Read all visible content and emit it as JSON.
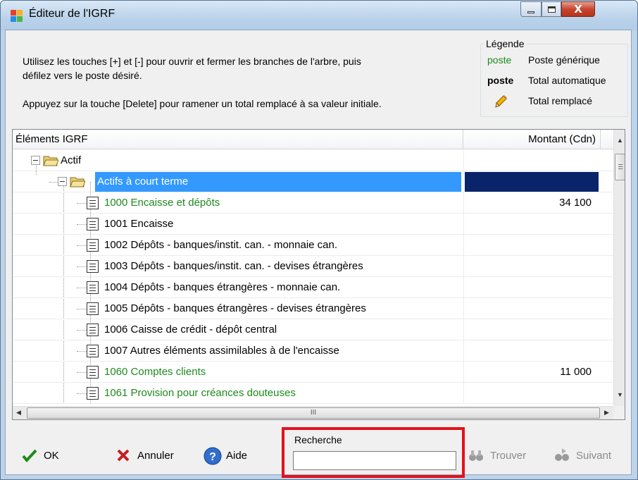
{
  "window": {
    "title": "Éditeur de l'IGRF",
    "close_glyph": "X"
  },
  "instructions": {
    "line1": "Utilisez les touches [+] et [-] pour ouvrir et fermer les branches de l'arbre, puis",
    "line2": "défilez vers le poste désiré.",
    "line3": "Appuyez sur la touche [Delete] pour ramener un total remplacé à sa valeur initiale."
  },
  "legend": {
    "title": "Légende",
    "items": [
      {
        "sample": "poste",
        "desc": "Poste générique",
        "style": "green"
      },
      {
        "sample": "poste",
        "desc": "Total automatique",
        "style": "bold"
      },
      {
        "sample": "",
        "desc": "Total remplacé",
        "style": "pencil-icon"
      }
    ]
  },
  "grid": {
    "col_items": "Éléments IGRF",
    "col_amount": "Montant (Cdn)",
    "rows": [
      {
        "label": "Actif",
        "amount": "",
        "type": "folder",
        "level": 0,
        "green": false
      },
      {
        "label": "Actifs à court terme",
        "amount": "",
        "type": "folder",
        "level": 1,
        "green": false,
        "selected": true
      },
      {
        "label": "1000  Encaisse et dépôts",
        "amount": "34 100",
        "type": "doc",
        "level": 2,
        "green": true
      },
      {
        "label": "1001  Encaisse",
        "amount": "",
        "type": "doc",
        "level": 2,
        "green": false
      },
      {
        "label": "1002  Dépôts - banques/instit. can. - monnaie can.",
        "amount": "",
        "type": "doc",
        "level": 2,
        "green": false
      },
      {
        "label": "1003  Dépôts - banques/instit. can. - devises étrangères",
        "amount": "",
        "type": "doc",
        "level": 2,
        "green": false
      },
      {
        "label": "1004  Dépôts - banques étrangères - monnaie can.",
        "amount": "",
        "type": "doc",
        "level": 2,
        "green": false
      },
      {
        "label": "1005  Dépôts - banques étrangères - devises étrangères",
        "amount": "",
        "type": "doc",
        "level": 2,
        "green": false
      },
      {
        "label": "1006  Caisse de crédit - dépôt central",
        "amount": "",
        "type": "doc",
        "level": 2,
        "green": false
      },
      {
        "label": "1007  Autres éléments assimilables à de l'encaisse",
        "amount": "",
        "type": "doc",
        "level": 2,
        "green": false
      },
      {
        "label": "1060  Comptes clients",
        "amount": "11 000",
        "type": "doc",
        "level": 2,
        "green": true
      },
      {
        "label": "1061  Provision pour créances douteuses",
        "amount": "",
        "type": "doc",
        "level": 2,
        "green": true
      }
    ],
    "hscroll_grip": "III"
  },
  "buttons": {
    "ok": "OK",
    "cancel": "Annuler",
    "help": "Aide",
    "find": "Trouver",
    "next": "Suivant"
  },
  "search": {
    "label": "Recherche",
    "value": ""
  },
  "colors": {
    "green_item": "#1e8a1e",
    "selection": "#3399ff",
    "highlight_box": "#e3121b"
  }
}
